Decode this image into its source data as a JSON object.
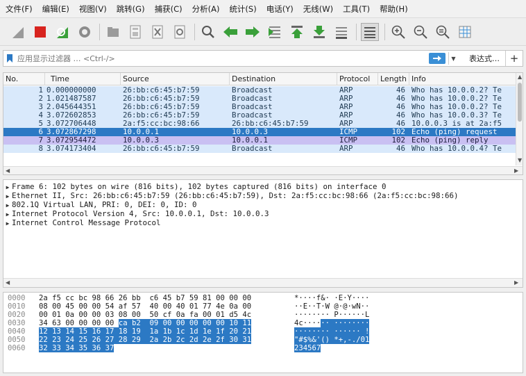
{
  "menu": [
    "文件(F)",
    "编辑(E)",
    "视图(V)",
    "跳转(G)",
    "捕获(C)",
    "分析(A)",
    "统计(S)",
    "电话(Y)",
    "无线(W)",
    "工具(T)",
    "帮助(H)"
  ],
  "toolbar_icons": [
    "shark-fin-icon",
    "stop-icon",
    "restart-icon",
    "options-gear-icon",
    "open-file-icon",
    "save-file-icon",
    "close-file-icon",
    "reload-icon",
    "find-icon",
    "go-back-icon",
    "go-forward-icon",
    "go-to-packet-icon",
    "go-first-icon",
    "go-last-icon",
    "autoscroll-icon",
    "colorize-icon",
    "zoom-in-icon",
    "zoom-out-icon",
    "zoom-normal-icon",
    "resize-columns-icon"
  ],
  "filter": {
    "placeholder": "应用显示过滤器 … <Ctrl-/>",
    "expression_label": "表达式…",
    "plus_label": "+"
  },
  "packet_list": {
    "columns": [
      "No.",
      "Time",
      "Source",
      "Destination",
      "Protocol",
      "Length",
      "Info"
    ],
    "rows": [
      {
        "no": "1",
        "time": "0.000000000",
        "src": "26:bb:c6:45:b7:59",
        "dst": "Broadcast",
        "proto": "ARP",
        "len": "46",
        "info": "Who has 10.0.0.2? Te",
        "kind": "arp"
      },
      {
        "no": "2",
        "time": "1.021487587",
        "src": "26:bb:c6:45:b7:59",
        "dst": "Broadcast",
        "proto": "ARP",
        "len": "46",
        "info": "Who has 10.0.0.2? Te",
        "kind": "arp"
      },
      {
        "no": "3",
        "time": "2.045644351",
        "src": "26:bb:c6:45:b7:59",
        "dst": "Broadcast",
        "proto": "ARP",
        "len": "46",
        "info": "Who has 10.0.0.2? Te",
        "kind": "arp"
      },
      {
        "no": "4",
        "time": "3.072602853",
        "src": "26:bb:c6:45:b7:59",
        "dst": "Broadcast",
        "proto": "ARP",
        "len": "46",
        "info": "Who has 10.0.0.3? Te",
        "kind": "arp"
      },
      {
        "no": "5",
        "time": "3.072706448",
        "src": "2a:f5:cc:bc:98:66",
        "dst": "26:bb:c6:45:b7:59",
        "proto": "ARP",
        "len": "46",
        "info": "10.0.0.3 is at 2a:f5",
        "kind": "arp"
      },
      {
        "no": "6",
        "time": "3.072867298",
        "src": "10.0.0.1",
        "dst": "10.0.0.3",
        "proto": "ICMP",
        "len": "102",
        "info": "Echo (ping) request",
        "kind": "sel"
      },
      {
        "no": "7",
        "time": "3.072954472",
        "src": "10.0.0.3",
        "dst": "10.0.0.1",
        "proto": "ICMP",
        "len": "102",
        "info": "Echo (ping) reply",
        "kind": "icmp"
      },
      {
        "no": "8",
        "time": "3.074173404",
        "src": "26:bb:c6:45:b7:59",
        "dst": "Broadcast",
        "proto": "ARP",
        "len": "46",
        "info": "Who has 10.0.0.4? Te",
        "kind": "arp"
      }
    ]
  },
  "details": [
    "Frame 6: 102 bytes on wire (816 bits), 102 bytes captured (816 bits) on interface 0",
    "Ethernet II, Src: 26:bb:c6:45:b7:59 (26:bb:c6:45:b7:59), Dst: 2a:f5:cc:bc:98:66 (2a:f5:cc:bc:98:66)",
    "802.1Q Virtual LAN, PRI: 0, DEI: 0, ID: 0",
    "Internet Protocol Version 4, Src: 10.0.0.1, Dst: 10.0.0.3",
    "Internet Control Message Protocol"
  ],
  "bytes": [
    {
      "off": "0000",
      "hex_a": "2a f5 cc bc 98 66 26 bb  c6 45 b7 59 81 00 00 00",
      "hex_b": "",
      "asc_a": "*····f&· ·E·Y····",
      "asc_b": ""
    },
    {
      "off": "0010",
      "hex_a": "08 00 45 00 00 54 af 57  40 00 40 01 77 4e 0a 00",
      "hex_b": "",
      "asc_a": "··E··T·W @·@·wN··",
      "asc_b": ""
    },
    {
      "off": "0020",
      "hex_a": "00 01 0a 00 00 03 08 00  50 cf 0a fa 00 01 d5 4c",
      "hex_b": "",
      "asc_a": "········ P······L",
      "asc_b": ""
    },
    {
      "off": "0030",
      "hex_a": "34 63 00 00 00 00 ",
      "hex_b": "ca b2  09 00 00 00 00 00 10 11",
      "asc_a": "4c····",
      "asc_b": "·· ········"
    },
    {
      "off": "0040",
      "hex_a": "",
      "hex_b": "12 13 14 15 16 17 18 19  1a 1b 1c 1d 1e 1f 20 21",
      "asc_a": "",
      "asc_b": "········ ······ !"
    },
    {
      "off": "0050",
      "hex_a": "",
      "hex_b": "22 23 24 25 26 27 28 29  2a 2b 2c 2d 2e 2f 30 31",
      "asc_a": "",
      "asc_b": "\"#$%&'() *+,-./01"
    },
    {
      "off": "0060",
      "hex_a": "",
      "hex_b": "32 33 34 35 36 37",
      "asc_a": "",
      "asc_b": "234567"
    }
  ],
  "colors": {
    "selected": "#2c79c4",
    "arp_row": "#d9e9fb",
    "icmp_row": "#c9c0f2",
    "accent": "#3a8fd6"
  }
}
